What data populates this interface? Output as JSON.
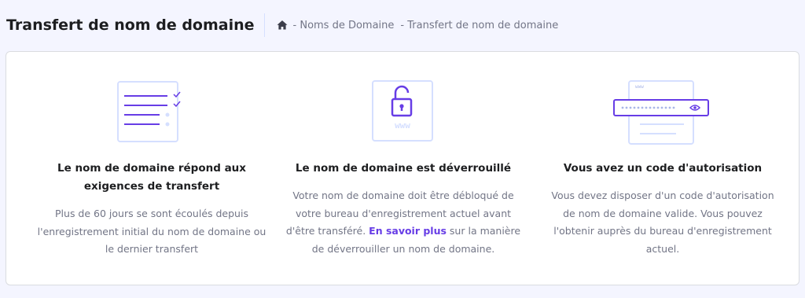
{
  "header": {
    "title": "Transfert de nom de domaine",
    "breadcrumb": [
      "- Noms de Domaine",
      "- Transfert de nom de domaine"
    ]
  },
  "steps": [
    {
      "icon": "checklist-icon",
      "title": "Le nom de domaine répond aux exigences de transfert",
      "description": "Plus de 60 jours se sont écoulés depuis l'enregistrement initial du nom de domaine ou le dernier transfert"
    },
    {
      "icon": "unlocked-padlock-icon",
      "icon_text": "www",
      "title": "Le nom de domaine est déverrouillé",
      "description_before": "Votre nom de domaine doit être débloqué de votre bureau d'enregistrement actuel avant d'être transféré.",
      "link_label": "En savoir plus",
      "description_after": "sur la manière de déverrouiller un nom de domaine."
    },
    {
      "icon": "auth-code-browser-icon",
      "icon_text": "www",
      "title": "Vous avez un code d'autorisation",
      "description": "Vous devez disposer d'un code d'autorisation de nom de domaine valide. Vous pouvez l'obtenir auprès du bureau d'enregistrement actuel."
    }
  ],
  "colors": {
    "accent": "#673de6",
    "light_accent": "#d5dfff",
    "title": "#1d1e20",
    "text_muted": "#727586"
  }
}
